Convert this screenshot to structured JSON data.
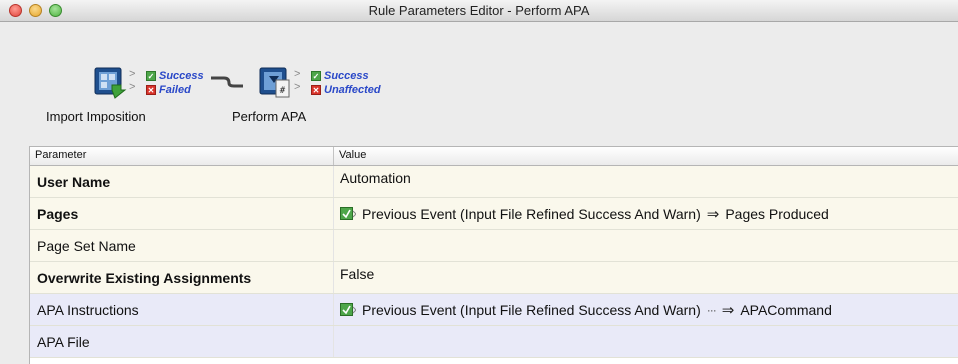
{
  "window": {
    "title": "Rule Parameters Editor - Perform APA"
  },
  "flow": {
    "nodes": [
      {
        "label": "Import Imposition",
        "icon": "import-imposition-icon",
        "outcomes": [
          {
            "label": "Success",
            "status": "ok"
          },
          {
            "label": "Failed",
            "status": "bad"
          }
        ]
      },
      {
        "label": "Perform APA",
        "icon": "perform-apa-icon",
        "outcomes": [
          {
            "label": "Success",
            "status": "ok"
          },
          {
            "label": "Unaffected",
            "status": "bad"
          }
        ]
      }
    ]
  },
  "table": {
    "headers": {
      "parameter": "Parameter",
      "value": "Value"
    },
    "rows": [
      {
        "parameter": "User Name",
        "value": "Automation"
      },
      {
        "parameter": "Pages",
        "source": "Previous Event (Input File Refined Success And Warn)",
        "target": "Pages Produced"
      },
      {
        "parameter": "Page Set Name",
        "value": ""
      },
      {
        "parameter": "Overwrite Existing Assignments",
        "value": "False"
      },
      {
        "parameter": "APA Instructions",
        "source": "Previous Event (Input File Refined Success And Warn)",
        "more": "···",
        "target": "APACommand"
      },
      {
        "parameter": "APA File",
        "value": ""
      }
    ]
  },
  "colors": {
    "accent_link": "#2a48c8",
    "success": "#4ea64a",
    "failure": "#d9342b",
    "row_tan": "#faf8ec",
    "row_blue": "#e9eaf8"
  }
}
